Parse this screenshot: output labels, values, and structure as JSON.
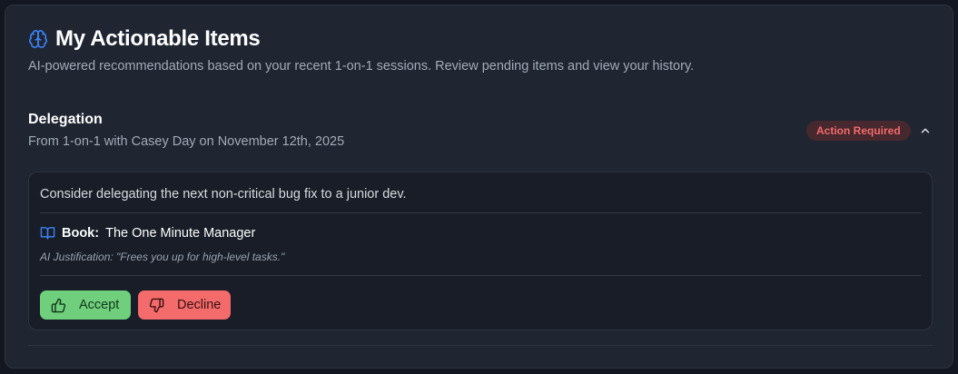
{
  "header": {
    "title": "My Actionable Items",
    "subtitle": "AI-powered recommendations based on your recent 1-on-1 sessions. Review pending items and view your history.",
    "icon": "brain-icon",
    "accent_color": "#3b82f6"
  },
  "item": {
    "title": "Delegation",
    "meta": "From 1-on-1 with Casey Day on November 12th, 2025",
    "badge": "Action Required",
    "badge_color": "#f26b6b",
    "expanded": true,
    "suggestion": "Consider delegating the next non-critical bug fix to a junior dev.",
    "resource": {
      "type_label": "Book:",
      "title": "The One Minute Manager",
      "icon": "book-open-icon"
    },
    "justification": "AI Justification: \"Frees you up for high-level tasks.\"",
    "actions": {
      "accept_label": "Accept",
      "decline_label": "Decline",
      "accept_color": "#6fcf7c",
      "decline_color": "#f36b6b"
    }
  }
}
